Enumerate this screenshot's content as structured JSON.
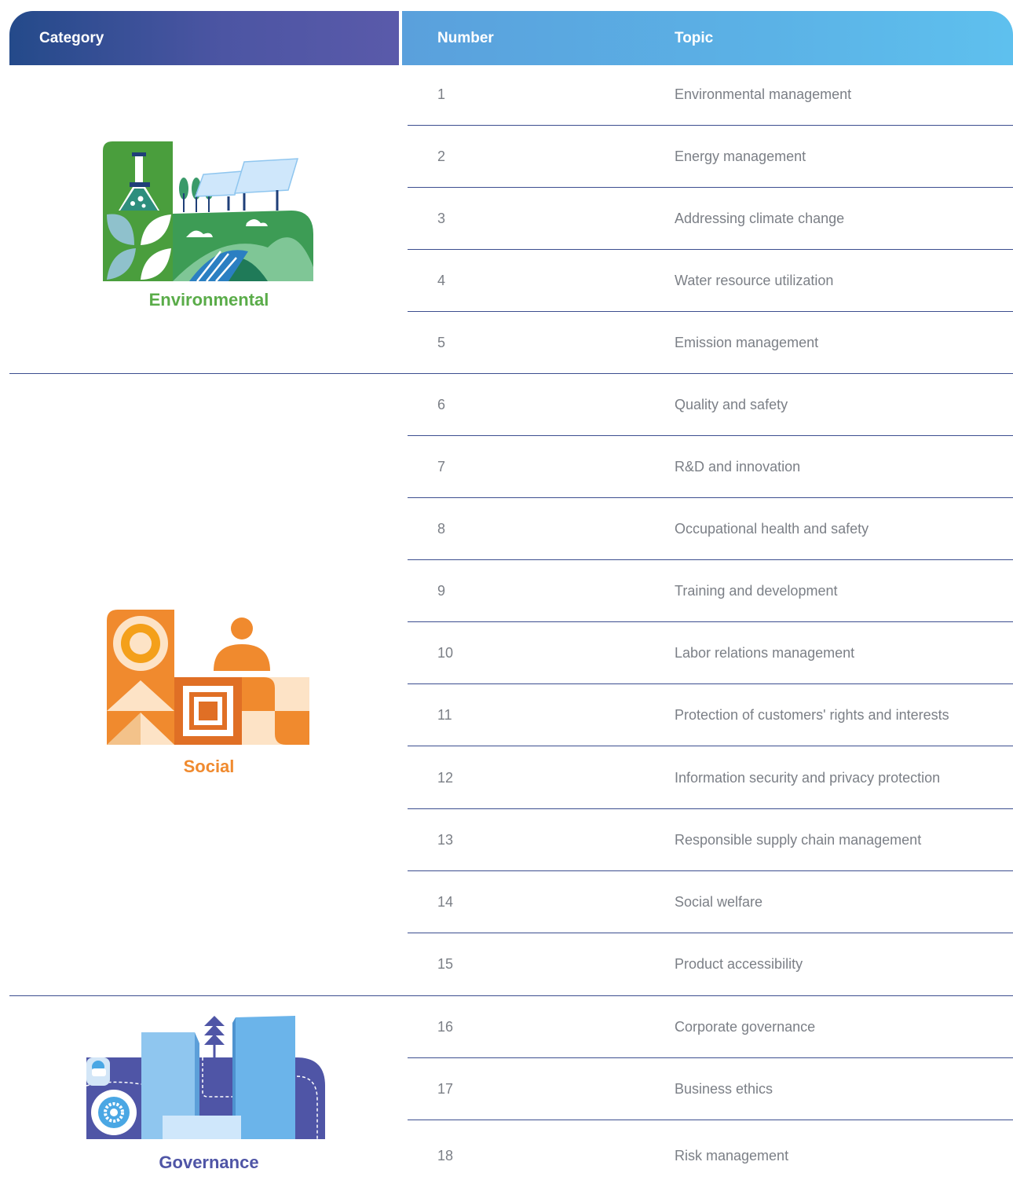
{
  "header": {
    "category": "Category",
    "number": "Number",
    "topic": "Topic"
  },
  "categories": [
    {
      "name": "Environmental",
      "color": "#5aac49"
    },
    {
      "name": "Social",
      "color": "#f08a2e"
    },
    {
      "name": "Governance",
      "color": "#4f55a6"
    }
  ],
  "rows": [
    {
      "number": "1",
      "topic": "Environmental management"
    },
    {
      "number": "2",
      "topic": "Energy management"
    },
    {
      "number": "3",
      "topic": "Addressing climate change"
    },
    {
      "number": "4",
      "topic": "Water resource utilization"
    },
    {
      "number": "5",
      "topic": "Emission management"
    },
    {
      "number": "6",
      "topic": "Quality and safety"
    },
    {
      "number": "7",
      "topic": "R&D and innovation"
    },
    {
      "number": "8",
      "topic": "Occupational health and safety"
    },
    {
      "number": "9",
      "topic": "Training and development"
    },
    {
      "number": "10",
      "topic": "Labor relations management"
    },
    {
      "number": "11",
      "topic": "Protection of customers' rights and interests"
    },
    {
      "number": "12",
      "topic": "Information security and privacy protection"
    },
    {
      "number": "13",
      "topic": "Responsible supply chain management"
    },
    {
      "number": "14",
      "topic": "Social welfare"
    },
    {
      "number": "15",
      "topic": "Product accessibility"
    },
    {
      "number": "16",
      "topic": "Corporate governance"
    },
    {
      "number": "17",
      "topic": "Business ethics"
    },
    {
      "number": "18",
      "topic": "Risk management"
    }
  ]
}
